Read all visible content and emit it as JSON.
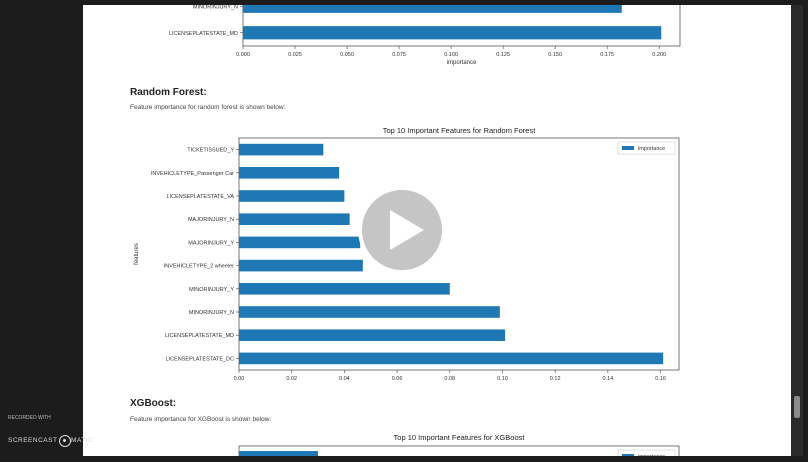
{
  "sections": {
    "rf_heading": "Random Forest:",
    "rf_text": "Feature importance for random forest is shown below:",
    "xgb_heading": "XGBoost:",
    "xgb_text": "Feature importance for XGBoost is shown below:"
  },
  "watermark": {
    "line1": "RECORDED WITH",
    "brand_left": "SCREENCAST",
    "brand_right": "MATIC"
  },
  "colors": {
    "bar": "#1f77b4",
    "page": "#ffffff",
    "frame": "#1c1c1c"
  },
  "icons": {
    "play": "play-icon"
  },
  "chart_data": [
    {
      "type": "bar",
      "orientation": "horizontal",
      "title": "",
      "xlabel": "importance",
      "ylabel": "",
      "categories": [
        "MINORINJURY_N",
        "LICENSEPLATESTATE_MD"
      ],
      "values": [
        0.182,
        0.201
      ],
      "xlim": [
        0,
        0.21
      ],
      "xticks": [
        "0.000",
        "0.025",
        "0.050",
        "0.075",
        "0.100",
        "0.125",
        "0.150",
        "0.175",
        "0.200"
      ],
      "grid": false,
      "note_visible": "partially cropped at top"
    },
    {
      "type": "bar",
      "orientation": "horizontal",
      "title": "Top 10 Important Features for Random Forest",
      "xlabel": "importance",
      "ylabel": "features",
      "legend": [
        "importance"
      ],
      "legend_position": "top-right",
      "categories": [
        "TICKETISSUED_Y",
        "INVEHICLETYPE_Passenger Car",
        "LICENSEPLATESTATE_VA",
        "MAJORINJURY_N",
        "MAJORINJURY_Y",
        "INVEHICLETYPE_2 wheeler",
        "MINORINJURY_Y",
        "MINORINJURY_N",
        "LICENSEPLATESTATE_MD",
        "LICENSEPLATESTATE_DC"
      ],
      "values": [
        0.032,
        0.038,
        0.04,
        0.042,
        0.046,
        0.047,
        0.08,
        0.099,
        0.101,
        0.161
      ],
      "xlim": [
        0,
        0.167
      ],
      "xticks": [
        "0.00",
        "0.02",
        "0.04",
        "0.06",
        "0.08",
        "0.10",
        "0.12",
        "0.14",
        "0.16"
      ],
      "grid": false
    },
    {
      "type": "bar",
      "orientation": "horizontal",
      "title": "Top 10 Important Features for XGBoost",
      "legend": [
        "importance"
      ],
      "legend_position": "top-right",
      "note_visible": "only title, legend and top bar edge visible"
    }
  ]
}
